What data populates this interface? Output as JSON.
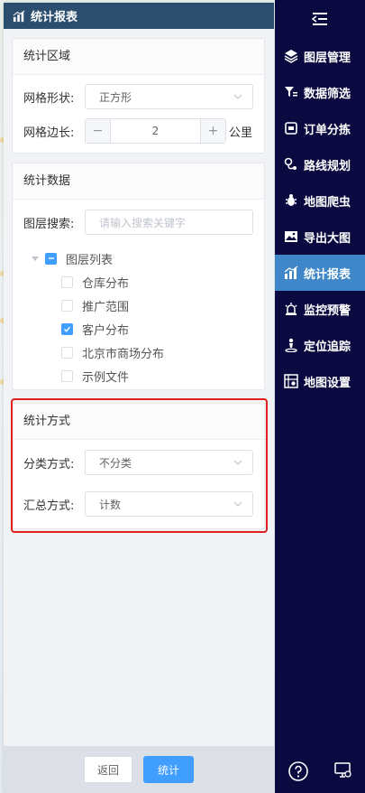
{
  "panel": {
    "title": "统计报表"
  },
  "region": {
    "title": "统计区域",
    "shape_label": "网格形状:",
    "shape_value": "正方形",
    "side_label": "网格边长:",
    "side_value": "2",
    "side_unit": "公里"
  },
  "stats_data": {
    "title": "统计数据",
    "search_label": "图层搜索:",
    "search_placeholder": "请输入搜索关键字",
    "tree": {
      "root": {
        "label": "图层列表",
        "state": "indeterminate"
      },
      "children": [
        {
          "label": "仓库分布",
          "checked": false
        },
        {
          "label": "推广范围",
          "checked": false
        },
        {
          "label": "客户分布",
          "checked": true
        },
        {
          "label": "北京市商场分布",
          "checked": false
        },
        {
          "label": "示例文件",
          "checked": false
        }
      ]
    }
  },
  "method": {
    "title": "统计方式",
    "classify_label": "分类方式:",
    "classify_value": "不分类",
    "summary_label": "汇总方式:",
    "summary_value": "计数"
  },
  "footer": {
    "back_label": "返回",
    "submit_label": "统计"
  },
  "nav": {
    "items": [
      {
        "label": "图层管理",
        "icon": "layers-icon"
      },
      {
        "label": "数据筛选",
        "icon": "filter-icon"
      },
      {
        "label": "订单分拣",
        "icon": "order-icon"
      },
      {
        "label": "路线规划",
        "icon": "route-icon"
      },
      {
        "label": "地图爬虫",
        "icon": "bug-icon"
      },
      {
        "label": "导出大图",
        "icon": "image-export-icon"
      },
      {
        "label": "统计报表",
        "icon": "chart-icon",
        "active": true
      },
      {
        "label": "监控预警",
        "icon": "alarm-icon"
      },
      {
        "label": "定位追踪",
        "icon": "person-location-icon"
      },
      {
        "label": "地图设置",
        "icon": "map-settings-icon"
      }
    ]
  },
  "colors": {
    "nav_bg": "#0b0a40",
    "nav_active": "#3f87c8",
    "primary": "#409eff",
    "header": "#2b4e6e",
    "highlight_frame": "#e02020"
  }
}
